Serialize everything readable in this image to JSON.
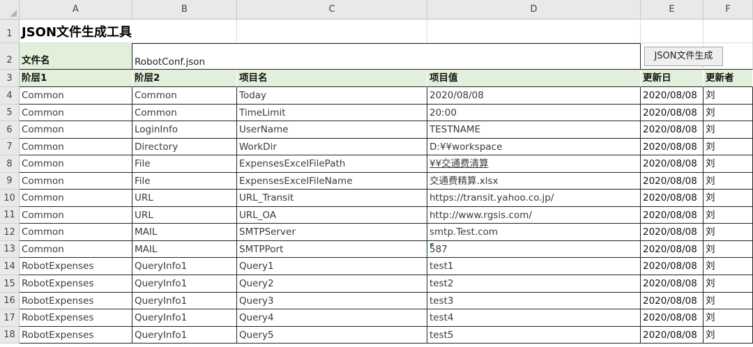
{
  "columns": [
    "A",
    "B",
    "C",
    "D",
    "E",
    "F"
  ],
  "row_numbers": [
    "1",
    "2",
    "3",
    "4",
    "5",
    "6",
    "7",
    "8",
    "9",
    "10",
    "11",
    "12",
    "13",
    "14",
    "15",
    "16",
    "17",
    "18"
  ],
  "sheet": {
    "title": "JSON文件生成工具",
    "file_label": "文件名",
    "file_name": "RobotConf.json",
    "generate_button": "JSON文件生成",
    "headers": [
      "阶层1",
      "阶层2",
      "项目名",
      "项目值",
      "更新日",
      "更新者"
    ]
  },
  "rows": [
    [
      "Common",
      "Common",
      "Today",
      "2020/08/08",
      "2020/08/08",
      "刘"
    ],
    [
      "Common",
      "Common",
      "TimeLimit",
      "20:00",
      "2020/08/08",
      "刘"
    ],
    [
      "Common",
      "LoginInfo",
      "UserName",
      "TESTNAME",
      "2020/08/08",
      "刘"
    ],
    [
      "Common",
      "Directory",
      "WorkDir",
      "D:¥¥workspace",
      "2020/08/08",
      "刘"
    ],
    [
      "Common",
      "File",
      "ExpensesExcelFilePath",
      "¥¥交通费清算",
      "2020/08/08",
      "刘"
    ],
    [
      "Common",
      "File",
      "ExpensesExcelFileName",
      "交通费精算.xlsx",
      "2020/08/08",
      "刘"
    ],
    [
      "Common",
      "URL",
      "URL_Transit",
      "https://transit.yahoo.co.jp/",
      "2020/08/08",
      "刘"
    ],
    [
      "Common",
      "URL",
      "URL_OA",
      "http://www.rgsis.com/",
      "2020/08/08",
      "刘"
    ],
    [
      "Common",
      "MAIL",
      "SMTPServer",
      "smtp.Test.com",
      "2020/08/08",
      "刘"
    ],
    [
      "Common",
      "MAIL",
      "SMTPPort",
      "587",
      "2020/08/08",
      "刘"
    ],
    [
      "RobotExpenses",
      "QueryInfo1",
      "Query1",
      "test1",
      "2020/08/08",
      "刘"
    ],
    [
      "RobotExpenses",
      "QueryInfo1",
      "Query2",
      "test2",
      "2020/08/08",
      "刘"
    ],
    [
      "RobotExpenses",
      "QueryInfo1",
      "Query3",
      "test3",
      "2020/08/08",
      "刘"
    ],
    [
      "RobotExpenses",
      "QueryInfo1",
      "Query4",
      "test4",
      "2020/08/08",
      "刘"
    ],
    [
      "RobotExpenses",
      "QueryInfo1",
      "Query5",
      "test5",
      "2020/08/08",
      "刘"
    ]
  ],
  "colors": {
    "header_fill": "#e2efda",
    "link": "#1a6fd6",
    "marker": "#1f8f3a"
  },
  "link_cell": {
    "row": 4,
    "col": 3
  },
  "error_marker_cell": {
    "row": 9,
    "col": 3
  }
}
